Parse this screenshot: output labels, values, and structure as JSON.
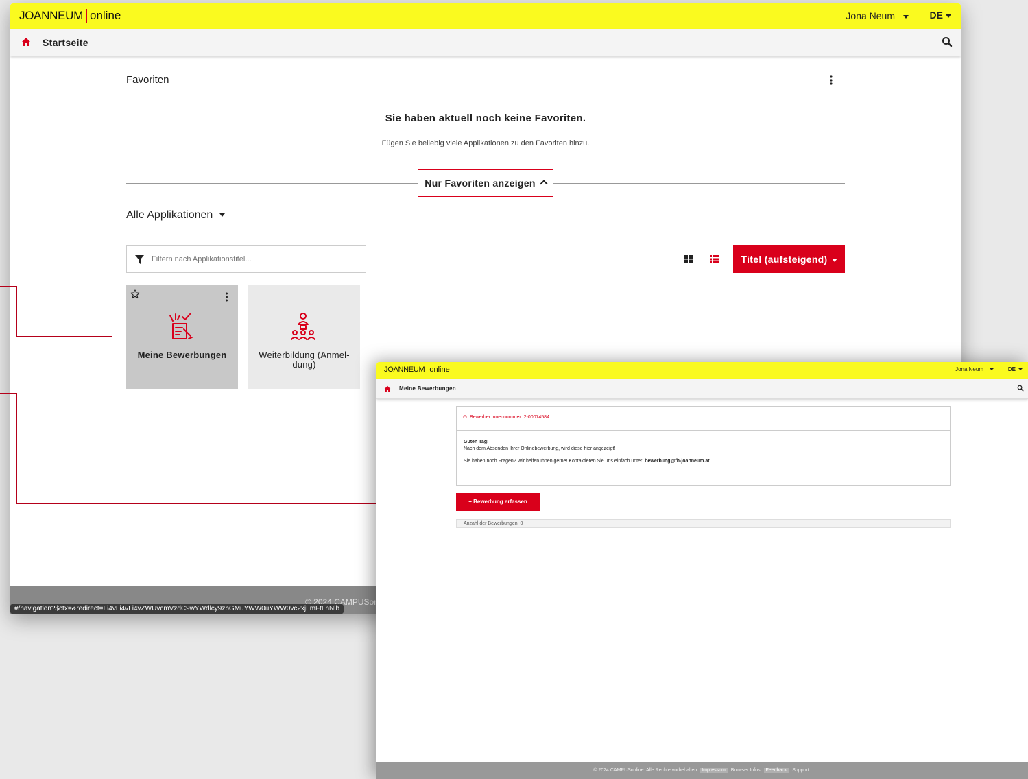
{
  "colors": {
    "topbar": "#fafa1f",
    "accent": "#d9001b"
  },
  "main_window": {
    "logo": {
      "brand": "JOANNEUM",
      "suffix": "online"
    },
    "user": "Jona Neum",
    "lang": "DE",
    "nav": {
      "title": "Startseite",
      "home_icon": "home-icon",
      "search_icon": "search-icon"
    },
    "favorites": {
      "title": "Favoriten",
      "empty_title": "Sie haben aktuell noch keine Favoriten.",
      "empty_sub": "Fügen Sie beliebig viele Applikationen zu den Favoriten hinzu.",
      "toggle_label": "Nur Favoriten anzeigen"
    },
    "apps": {
      "title": "Alle Applikationen",
      "filter_placeholder": "Filtern nach Applikationstitel...",
      "sort_label": "Titel (aufsteigend)",
      "tiles": [
        {
          "label": "Meine Bewerbungen",
          "icon": "application-form-icon"
        },
        {
          "label_line1": "Weiterbildung (Anmel-",
          "label_line2": "dung)",
          "icon": "group-training-icon"
        }
      ]
    },
    "footer_copy": "© 2024 CAMPUSon",
    "status_url": "#/navigation?$ctx=&redirect=Li4vLi4vLi4vZWUvcmVzdC9wYWdlcy9zbGMuYWW0uYWW0vc2xjLmFtLnNlb"
  },
  "detail_window": {
    "logo": {
      "brand": "JOANNEUM",
      "suffix": "online"
    },
    "user": "Jona Neum",
    "lang": "DE",
    "nav": {
      "title": "Meine Bewerbungen"
    },
    "panel": {
      "header": "Bewerber:innennummer: 2-00074584",
      "greeting": "Guten Tag!",
      "line2": "Nach dem Absenden Ihrer Onlinebewerbung, wird diese hier angezeigt!",
      "line3": "Sie haben noch Fragen? Wir helfen Ihnen gerne! Kontaktieren Sie uns einfach unter:",
      "email": "bewerbung@fh-joanneum.at"
    },
    "add_button": "+ Bewerbung erfassen",
    "count_label": "Anzahl der Bewerbungen: 0",
    "footer": {
      "copyright": "© 2024 CAMPUSonline. Alle Rechte vorbehalten.",
      "links": [
        "Impressum",
        "Browser Infos",
        "Feedback",
        "Support"
      ]
    }
  }
}
